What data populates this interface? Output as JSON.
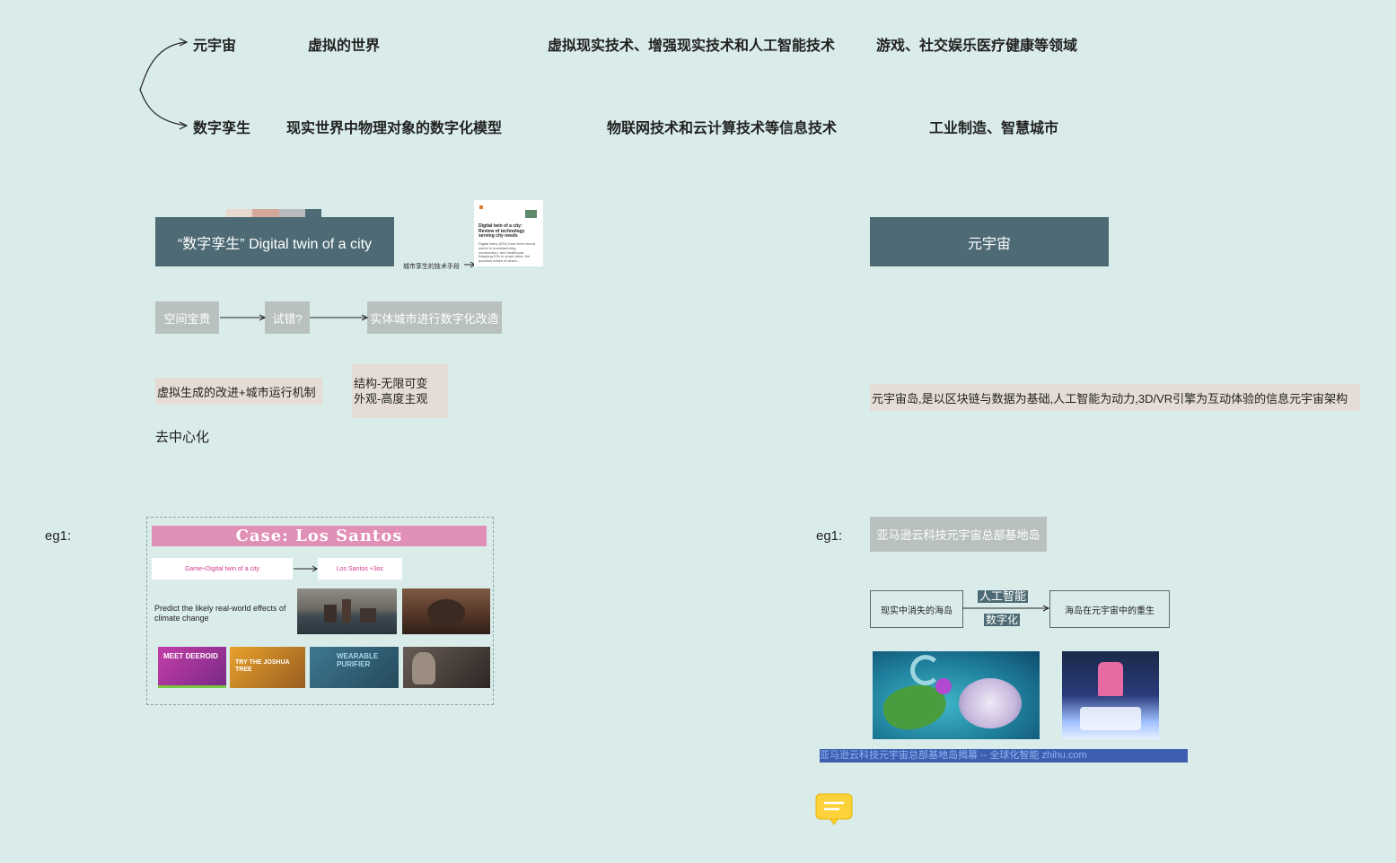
{
  "concepts": {
    "row1": {
      "name": "元宇宙",
      "definition": "虚拟的世界",
      "technology": "虚拟现实技术、增强现实技术和人工智能技术",
      "fields": "游戏、社交娱乐医疗健康等领域"
    },
    "row2": {
      "name": "数字孪生",
      "definition": "现实世界中物理对象的数字化模型",
      "technology": "物联网技术和云计算技术等信息技术",
      "fields": "工业制造、智慧城市"
    }
  },
  "left": {
    "header": "“数字孪生” Digital twin of a city",
    "arrow_label": "城市孪生的技术手段",
    "paper": {
      "title": "Digital twin of a city: Review of technology serving city needs",
      "abstract": "Digital twins (DTs) have been found useful in manufacturing, construction, and healthcare. Adapting DTs to smart cities, the question arises of which..."
    },
    "flow": [
      "空间宝贵",
      "试错?",
      "实体城市进行数字化改造"
    ],
    "note1": "虚拟生成的改进+城市运行机制",
    "note2_line1": "结构-无限可变",
    "note2_line2": "外观-高度主观",
    "note3": "去中心化",
    "eg_label": "eg1:",
    "case": {
      "title": "Case: Los Santos",
      "flow_left": "Game+Digital twin of a city",
      "flow_right": "Los Santos +3oc",
      "predict_text": "Predict the likely real-world effects of climate change",
      "billboard1": "MEET DEEROID",
      "billboard2": "TRY THE JOSHUA TREE",
      "billboard3": "WEARABLE PURIFIER"
    }
  },
  "right": {
    "header": "元宇宙",
    "description": "元宇宙岛,是以区块链与数据为基础,人工智能为动力,3D/VR引擎为互动体验的信息元宇宙架构",
    "eg_label": "eg1:",
    "example_title": "亚马逊云科技元宇宙总部基地岛",
    "flow_left": "现实中消失的海岛",
    "flow_top": "人工智能",
    "flow_bottom": "数字化",
    "flow_right": "海岛在元宇宙中的重生",
    "caption": "亚马逊云科技元宇宙总部基地岛揭幕 -- 全球化智能 zhihu.com"
  },
  "comment_icon": "comment-icon",
  "colors": {
    "background": "#d9ecea",
    "header_box": "#4e6b75",
    "gray_box": "#b9c1bf",
    "beige_box": "#e5ddd5",
    "case_title": "#e08fb7"
  }
}
